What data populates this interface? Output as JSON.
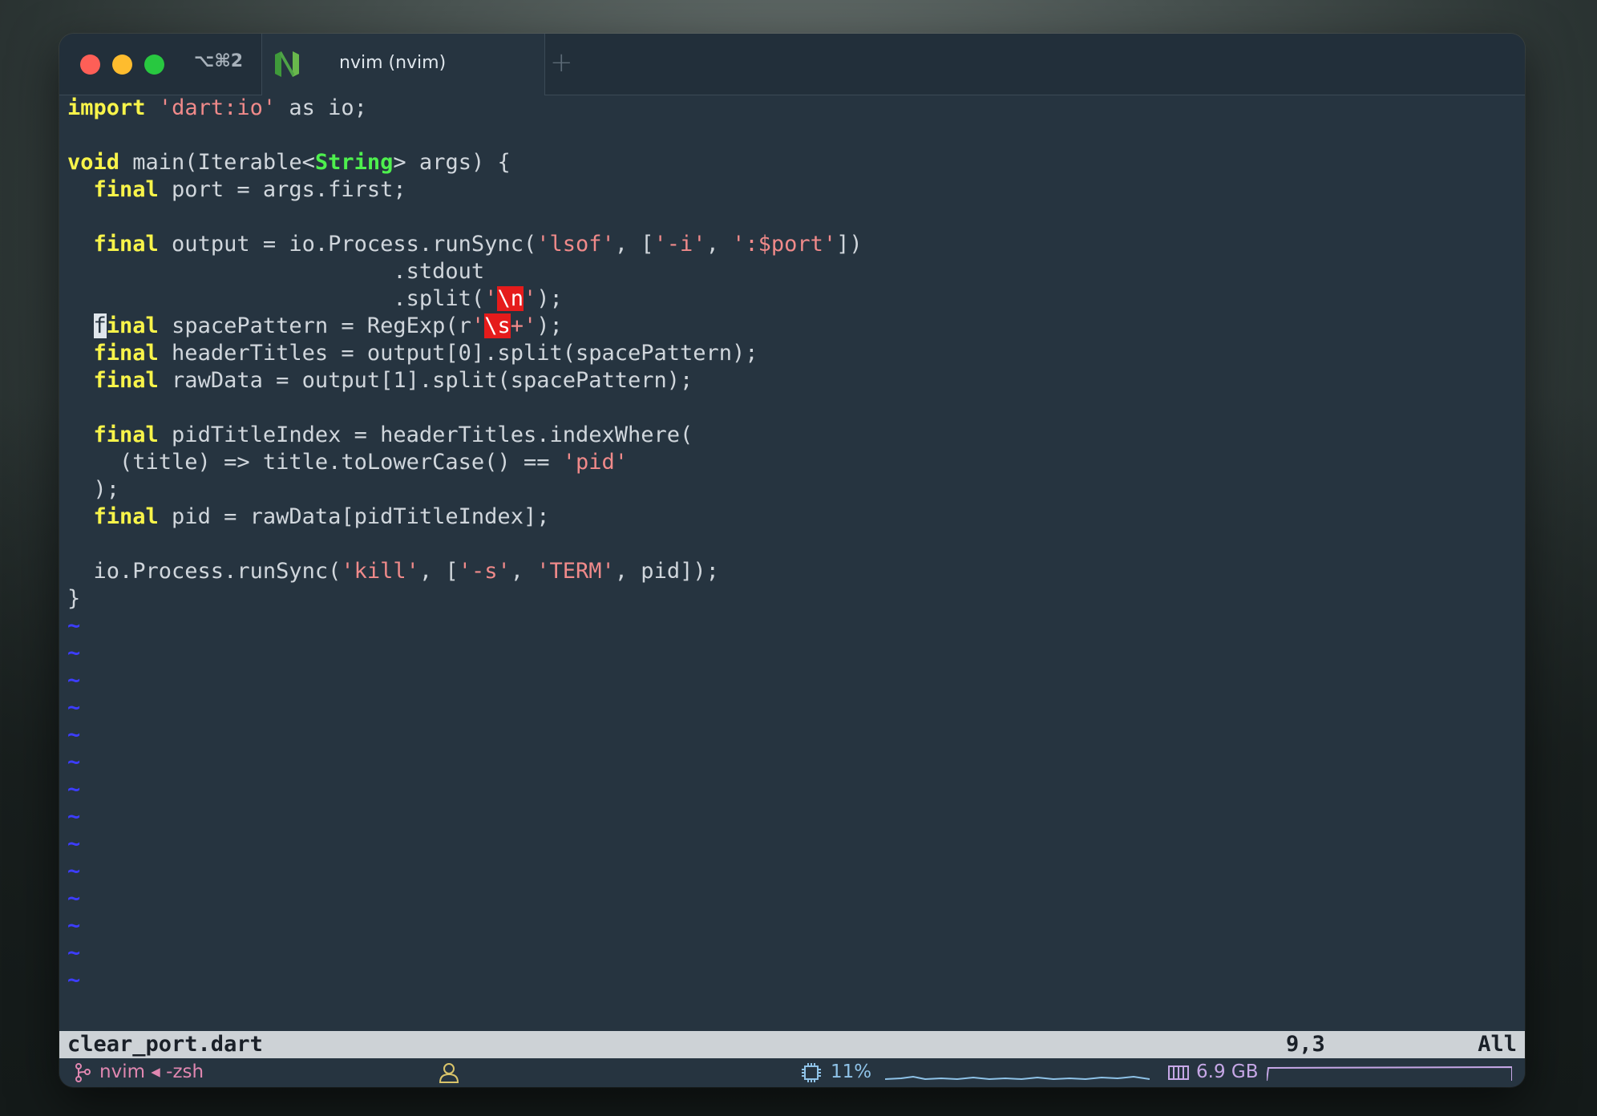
{
  "titlebar": {
    "shortcut": "⌥⌘2",
    "tab_title": "nvim (nvim)",
    "new_tab": "+"
  },
  "code_lines": [
    [
      {
        "t": "import",
        "c": "kw"
      },
      {
        "t": " "
      },
      {
        "t": "'dart:io'",
        "c": "str"
      },
      {
        "t": " as io;"
      }
    ],
    [],
    [
      {
        "t": "void",
        "c": "kw"
      },
      {
        "t": " main(Iterable<"
      },
      {
        "t": "String",
        "c": "ty"
      },
      {
        "t": "> args) {"
      }
    ],
    [
      {
        "t": "  "
      },
      {
        "t": "final",
        "c": "kw"
      },
      {
        "t": " port = args.first;"
      }
    ],
    [],
    [
      {
        "t": "  "
      },
      {
        "t": "final",
        "c": "kw"
      },
      {
        "t": " output = io.Process.runSync("
      },
      {
        "t": "'lsof'",
        "c": "str"
      },
      {
        "t": ", ["
      },
      {
        "t": "'-i'",
        "c": "str"
      },
      {
        "t": ", "
      },
      {
        "t": "':$port'",
        "c": "str"
      },
      {
        "t": "])"
      }
    ],
    [
      {
        "t": "                         .stdout"
      }
    ],
    [
      {
        "t": "                         .split("
      },
      {
        "t": "'",
        "c": "str"
      },
      {
        "t": "\\n",
        "c": "esc"
      },
      {
        "t": "'",
        "c": "str"
      },
      {
        "t": ");"
      }
    ],
    [
      {
        "t": "  "
      },
      {
        "t": "f",
        "c": "cursor"
      },
      {
        "t": "inal",
        "c": "kw"
      },
      {
        "t": " spacePattern = RegExp(r"
      },
      {
        "t": "'",
        "c": "str"
      },
      {
        "t": "\\s",
        "c": "esc"
      },
      {
        "t": "+'",
        "c": "str"
      },
      {
        "t": ");"
      }
    ],
    [
      {
        "t": "  "
      },
      {
        "t": "final",
        "c": "kw"
      },
      {
        "t": " headerTitles = output[0].split(spacePattern);"
      }
    ],
    [
      {
        "t": "  "
      },
      {
        "t": "final",
        "c": "kw"
      },
      {
        "t": " rawData = output[1].split(spacePattern);"
      }
    ],
    [],
    [
      {
        "t": "  "
      },
      {
        "t": "final",
        "c": "kw"
      },
      {
        "t": " pidTitleIndex = headerTitles.indexWhere("
      }
    ],
    [
      {
        "t": "    (title) => title.toLowerCase() == "
      },
      {
        "t": "'pid'",
        "c": "str"
      }
    ],
    [
      {
        "t": "  );"
      }
    ],
    [
      {
        "t": "  "
      },
      {
        "t": "final",
        "c": "kw"
      },
      {
        "t": " pid = rawData[pidTitleIndex];"
      }
    ],
    [],
    [
      {
        "t": "  io.Process.runSync("
      },
      {
        "t": "'kill'",
        "c": "str"
      },
      {
        "t": ", ["
      },
      {
        "t": "'-s'",
        "c": "str"
      },
      {
        "t": ", "
      },
      {
        "t": "'TERM'",
        "c": "str"
      },
      {
        "t": ", pid]);"
      }
    ],
    [
      {
        "t": "}"
      }
    ]
  ],
  "tilde_char": "~",
  "tilde_count": 14,
  "statusline": {
    "filename": "clear_port.dart",
    "position": "9,3",
    "scroll": "All"
  },
  "bottombar": {
    "session": "nvim ◂ -zsh",
    "cpu": "11%",
    "memory": "6.9 GB"
  },
  "colors": {
    "keyword": "#f8f44a",
    "type": "#4ef04e",
    "string": "#f08a8a",
    "escape_bg": "#e51b1b",
    "tilde": "#3d3dff",
    "background": "#263440"
  }
}
